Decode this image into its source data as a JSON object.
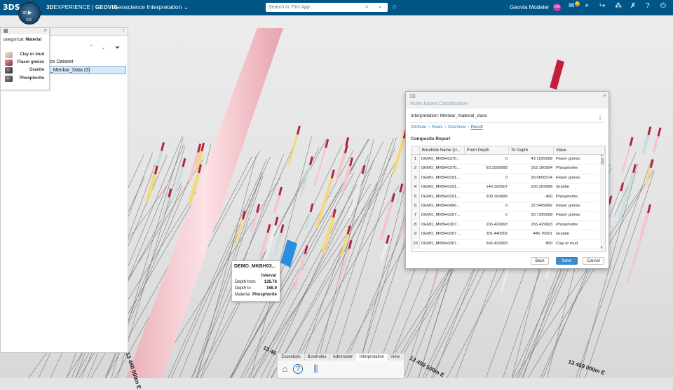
{
  "topbar": {
    "logo": "3DS",
    "compass_letters": [
      "3D",
      "V.R"
    ],
    "brand_prefix": "3D",
    "brand_main": "EXPERIENCE",
    "brand_sep": " | ",
    "brand_suffix": "GEOVIA",
    "app_title": "Geoscience Interpretation",
    "search_placeholder": "Search in This App",
    "user_name": "Geovia Modeler",
    "avatar_initials": "GM",
    "notification_count": "5",
    "colors": {
      "bar": "#005686",
      "avatar": "#c83aa6",
      "badge": "#f0a400"
    }
  },
  "left_panel": {
    "tree_item_1": "ce Dataset",
    "tree_item_2": "_Menkar_Data (3)"
  },
  "legend": {
    "title_prefix": "categorical:",
    "title_attr": "Material",
    "items": [
      {
        "label": "Clay or mud",
        "color": "#d8c3b3"
      },
      {
        "label": "Flaser gneiss",
        "color": "#c1566c"
      },
      {
        "label": "Granite",
        "color": "#3b3b3b"
      },
      {
        "label": "Phosphorite",
        "color": "#4a4a4a"
      }
    ]
  },
  "tooltip": {
    "title": "DEMO_MKBH03...",
    "interval_label": "Interval",
    "rows": [
      {
        "key": "Depth from",
        "value": "136.76"
      },
      {
        "key": "Depth to",
        "value": "168.9"
      },
      {
        "key": "Material",
        "value": "Phosphorite"
      }
    ]
  },
  "dialog": {
    "title": "Rules based Classification",
    "interpretation": "Interpretation: Menkar_material_class",
    "breadcrumbs": [
      "Attribute",
      "Rules",
      "Overview",
      "Result"
    ],
    "section": "Composite Report",
    "columns": [
      "Borehole Name (U...",
      "From Depth",
      "To Depth",
      "Value"
    ],
    "rows": [
      [
        "1",
        "DEMO_MKBH0370...",
        "0",
        "43.1599998",
        "Flaser gneiss"
      ],
      [
        "2",
        "DEMO_MKBH0370...",
        "63.1599998",
        "163.160004",
        "Phosphorite"
      ],
      [
        "3",
        "DEMO_MKBH0291...",
        "0",
        "39.0600014",
        "Flaser gneiss"
      ],
      [
        "4",
        "DEMO_MKBH0291...",
        "140.320007",
        "200.309998",
        "Granite"
      ],
      [
        "5",
        "DEMO_MKBH0291...",
        "200.309998",
        "400",
        "Phosphorite"
      ],
      [
        "6",
        "DEMO_MKBH0490...",
        "0",
        "22.5499992",
        "Flaser gneiss"
      ],
      [
        "7",
        "DEMO_MKBH0207...",
        "0",
        "30.7399998",
        "Flaser gneiss"
      ],
      [
        "8",
        "DEMO_MKBH0207...",
        "165.429993",
        "265.429993",
        "Phosphorite"
      ],
      [
        "9",
        "DEMO_MKBH0207...",
        "301.440002",
        "445.76001",
        "Granite"
      ],
      [
        "10",
        "DEMO_MKBH0207...",
        "565.429993",
        "800",
        "Clay or mud"
      ]
    ],
    "buttons": {
      "back": "Back",
      "save": "Save",
      "cancel": "Cancel"
    },
    "colors": {
      "save": "#3b8fd0",
      "link": "#2d7cb8"
    }
  },
  "actionbar": {
    "tabs": [
      "Essentials",
      "Boreholes",
      "Administer",
      "Interpretation",
      "View"
    ],
    "active_tab": "Interpretation"
  },
  "coordinates": [
    "13 460 500m E",
    "13 46",
    "13 459 500m E",
    "13 459 000m E"
  ]
}
